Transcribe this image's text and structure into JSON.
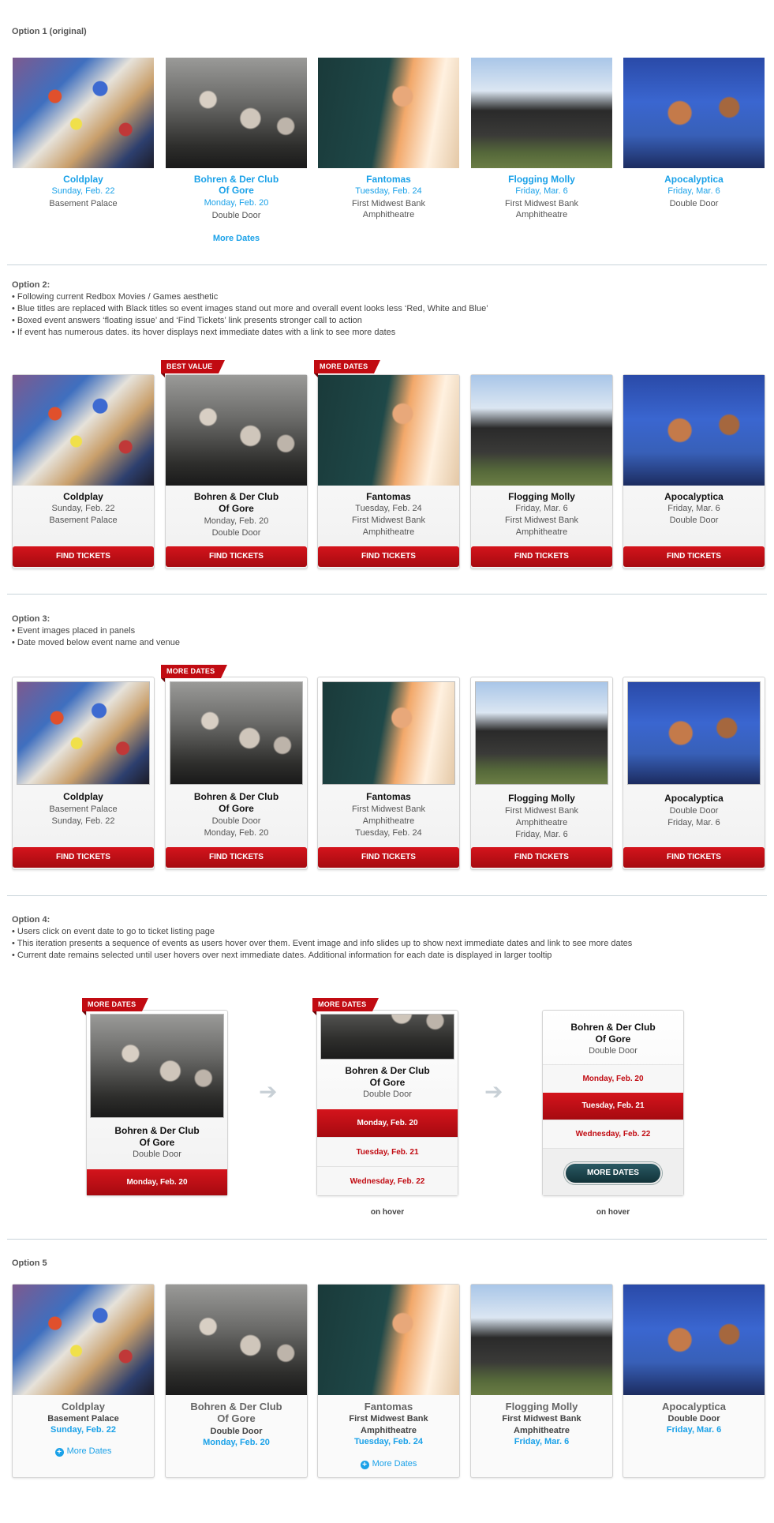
{
  "events": [
    {
      "name": "Coldplay",
      "date": "Sunday, Feb. 22",
      "venue": "Basement Palace",
      "photo_icon": "coldplay-photo"
    },
    {
      "name": "Bohren & Der Club Of Gore",
      "name_line1": "Bohren & Der Club",
      "name_line2": "Of Gore",
      "date": "Monday, Feb. 20",
      "venue": "Double Door",
      "photo_icon": "bohren-photo"
    },
    {
      "name": "Fantomas",
      "date": "Tuesday, Feb. 24",
      "venue_line1": "First Midwest Bank",
      "venue_line2": "Amphitheatre",
      "photo_icon": "fantomas-photo"
    },
    {
      "name": "Flogging Molly",
      "date": "Friday, Mar. 6",
      "venue_line1": "First Midwest Bank",
      "venue_line2": "Amphitheatre",
      "photo_icon": "flogging-molly-photo"
    },
    {
      "name": "Apocalyptica",
      "date": "Friday, Mar. 6",
      "venue": "Double Door",
      "photo_icon": "apocalyptica-photo"
    }
  ],
  "option1": {
    "title": "Option 1 (original)",
    "more_dates": "More Dates"
  },
  "option2": {
    "title": "Option 2:",
    "notes": [
      "• Following current Redbox Movies / Games aesthetic",
      "• Blue titles are replaced with Black titles so event images stand out more and overall event looks less ‘Red, White and Blue’",
      "• Boxed event answers ‘floating issue’ and ‘Find Tickets’ link presents stronger call to action",
      "• If event has numerous dates. its hover displays next immediate dates with a link to see more dates"
    ],
    "ribbon_best_value": "BEST VALUE",
    "ribbon_more_dates": "MORE DATES",
    "find_tickets": "FIND TICKETS"
  },
  "option3": {
    "title": "Option 3:",
    "notes": [
      "• Event images placed in panels",
      "• Date moved below event name and venue"
    ],
    "ribbon_more_dates": "MORE DATES",
    "find_tickets": "FIND TICKETS"
  },
  "option4": {
    "title": "Option 4:",
    "notes": [
      "• Users click on event date to go to ticket listing page",
      "• This iteration presents a sequence of events as users hover over them. Event image and info slides up to show next immediate dates and link to see more dates",
      "• Current date remains selected until user hovers over next immediate dates. Additional information for each date is displayed in larger tooltip"
    ],
    "ribbon_more_dates": "MORE DATES",
    "dates": [
      "Monday, Feb. 20",
      "Tuesday, Feb. 21",
      "Wednesday, Feb. 22"
    ],
    "more_dates_button": "MORE DATES",
    "on_hover": "on hover",
    "arrow": "➔"
  },
  "option5": {
    "title": "Option 5",
    "more_dates": "More Dates"
  },
  "colors": {
    "accent_blue": "#1aa1e8",
    "brand_red": "#c10b12",
    "pill_dark": "#123238"
  }
}
